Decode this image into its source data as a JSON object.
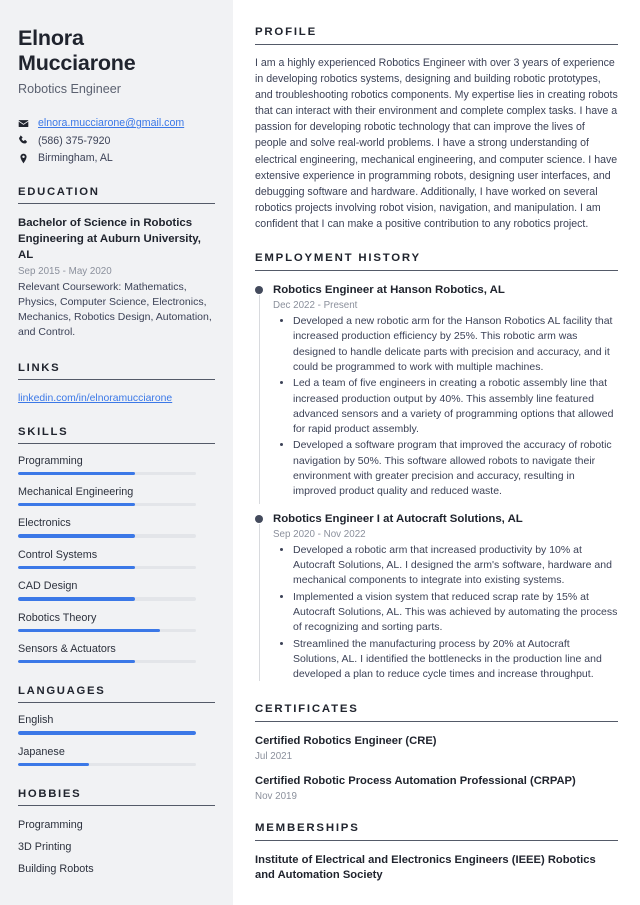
{
  "theme": {
    "accent": "#3b78e7",
    "sidebar_bg": "#f1f2f4",
    "page_bg": "#ffffff",
    "heading_color": "#20242e",
    "muted_color": "#8b909c"
  },
  "header": {
    "first_name": "Elnora",
    "last_name": "Mucciarone",
    "job_title": "Robotics Engineer"
  },
  "contact": {
    "email": "elnora.mucciarone@gmail.com",
    "phone": "(586) 375-7920",
    "location": "Birmingham, AL"
  },
  "education": {
    "heading": "EDUCATION",
    "items": [
      {
        "degree": "Bachelor of Science in Robotics Engineering at Auburn University, AL",
        "date": "Sep 2015 - May 2020",
        "description": "Relevant Coursework: Mathematics, Physics, Computer Science, Electronics, Mechanics, Robotics Design, Automation, and Control."
      }
    ]
  },
  "links": {
    "heading": "LINKS",
    "items": [
      {
        "label": "linkedin.com/in/elnoramucciarone"
      }
    ]
  },
  "skills": {
    "heading": "SKILLS",
    "items": [
      {
        "label": "Programming",
        "level": 66
      },
      {
        "label": "Mechanical Engineering",
        "level": 66
      },
      {
        "label": "Electronics",
        "level": 66
      },
      {
        "label": "Control Systems",
        "level": 66
      },
      {
        "label": "CAD Design",
        "level": 66
      },
      {
        "label": "Robotics Theory",
        "level": 80
      },
      {
        "label": "Sensors & Actuators",
        "level": 66
      }
    ]
  },
  "languages": {
    "heading": "LANGUAGES",
    "items": [
      {
        "label": "English",
        "level": 100
      },
      {
        "label": "Japanese",
        "level": 40
      }
    ]
  },
  "hobbies": {
    "heading": "HOBBIES",
    "items": [
      {
        "label": "Programming"
      },
      {
        "label": "3D Printing"
      },
      {
        "label": "Building Robots"
      }
    ]
  },
  "profile": {
    "heading": "PROFILE",
    "text": "I am a highly experienced Robotics Engineer with over 3 years of experience in developing robotics systems, designing and building robotic prototypes, and troubleshooting robotics components. My expertise lies in creating robots that can interact with their environment and complete complex tasks. I have a passion for developing robotic technology that can improve the lives of people and solve real-world problems. I have a strong understanding of electrical engineering, mechanical engineering, and computer science. I have extensive experience in programming robots, designing user interfaces, and debugging software and hardware. Additionally, I have worked on several robotics projects involving robot vision, navigation, and manipulation. I am confident that I can make a positive contribution to any robotics project."
  },
  "employment": {
    "heading": "EMPLOYMENT HISTORY",
    "jobs": [
      {
        "title": "Robotics Engineer at Hanson Robotics, AL",
        "date": "Dec 2022 - Present",
        "bullets": [
          "Developed a new robotic arm for the Hanson Robotics AL facility that increased production efficiency by 25%. This robotic arm was designed to handle delicate parts with precision and accuracy, and it could be programmed to work with multiple machines.",
          "Led a team of five engineers in creating a robotic assembly line that increased production output by 40%. This assembly line featured advanced sensors and a variety of programming options that allowed for rapid product assembly.",
          "Developed a software program that improved the accuracy of robotic navigation by 50%. This software allowed robots to navigate their environment with greater precision and accuracy, resulting in improved product quality and reduced waste."
        ]
      },
      {
        "title": "Robotics Engineer I at Autocraft Solutions, AL",
        "date": "Sep 2020 - Nov 2022",
        "bullets": [
          "Developed a robotic arm that increased productivity by 10% at Autocraft Solutions, AL. I designed the arm's software, hardware and mechanical components to integrate into existing systems.",
          "Implemented a vision system that reduced scrap rate by 15% at Autocraft Solutions, AL. This was achieved by automating the process of recognizing and sorting parts.",
          "Streamlined the manufacturing process by 20% at Autocraft Solutions, AL. I identified the bottlenecks in the production line and developed a plan to reduce cycle times and increase throughput."
        ]
      }
    ]
  },
  "certificates": {
    "heading": "CERTIFICATES",
    "items": [
      {
        "name": "Certified Robotics Engineer (CRE)",
        "date": "Jul 2021"
      },
      {
        "name": "Certified Robotic Process Automation Professional (CRPAP)",
        "date": "Nov 2019"
      }
    ]
  },
  "memberships": {
    "heading": "MEMBERSHIPS",
    "items": [
      {
        "name": "Institute of Electrical and Electronics Engineers (IEEE) Robotics and Automation Society"
      }
    ]
  }
}
